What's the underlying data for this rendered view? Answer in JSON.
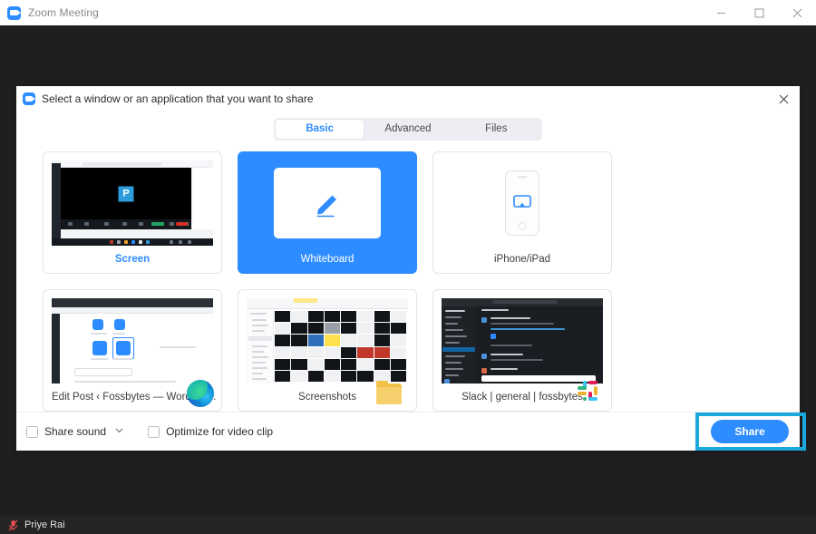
{
  "window": {
    "title": "Zoom Meeting",
    "logo_icon": "zoom-logo-icon",
    "controls": {
      "minimize_icon": "minimize-icon",
      "maximize_icon": "maximize-icon",
      "close_icon": "close-icon"
    }
  },
  "dialog": {
    "logo_icon": "zoom-logo-icon",
    "title": "Select a window or an application that you want to share",
    "close_icon": "close-icon",
    "tabs": [
      {
        "label": "Basic",
        "active": true
      },
      {
        "label": "Advanced",
        "active": false
      },
      {
        "label": "Files",
        "active": false
      }
    ],
    "cards": [
      {
        "label": "Screen",
        "style": "accent",
        "selected": false,
        "thumb": "desktop-screen-preview",
        "app_icon": null
      },
      {
        "label": "Whiteboard",
        "style": "selected",
        "selected": true,
        "thumb": "whiteboard-pencil-icon",
        "app_icon": null
      },
      {
        "label": "iPhone/iPad",
        "style": "plain",
        "selected": false,
        "thumb": "iphone-airplay-icon",
        "app_icon": null
      },
      {
        "label": "Edit Post ‹ Fossbytes — WordPre...",
        "style": "plain",
        "selected": false,
        "thumb": "wordpress-editor-preview",
        "app_icon": "microsoft-edge-icon"
      },
      {
        "label": "Screenshots",
        "style": "plain",
        "selected": false,
        "thumb": "file-explorer-preview",
        "app_icon": "folder-icon"
      },
      {
        "label": "Slack | general | fossbytes",
        "style": "plain",
        "selected": false,
        "thumb": "slack-window-preview",
        "app_icon": "slack-icon"
      }
    ],
    "footer": {
      "share_sound": {
        "label": "Share sound",
        "checked": false,
        "caret_icon": "chevron-down-icon"
      },
      "optimize_video": {
        "label": "Optimize for video clip",
        "checked": false
      },
      "share_button": {
        "label": "Share",
        "color": "#2d8cff",
        "highlighted": true
      }
    }
  },
  "statusbar": {
    "mic_icon": "microphone-muted-icon",
    "participant_name": "Priye Rai"
  },
  "colors": {
    "accent": "#2d8cff",
    "annotation": "#1aa8dd",
    "app_background": "#1f1f1f",
    "statusbar": "#242424",
    "tab_track": "#eceef3"
  }
}
